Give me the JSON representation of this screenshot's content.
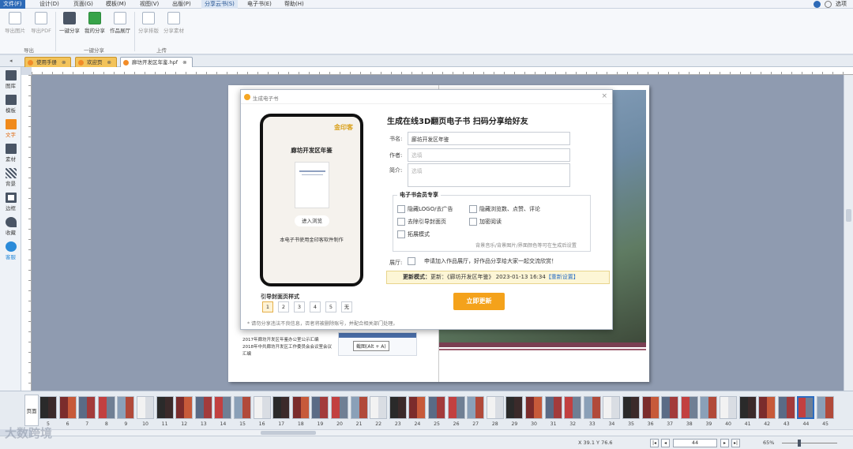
{
  "menubar": {
    "items": [
      "文件(F)",
      "设计(D)",
      "页面(G)",
      "模板(M)",
      "视图(V)",
      "出版(P)",
      "分享云书(S)",
      "电子书(E)",
      "帮助(H)"
    ],
    "active_index": 6,
    "right": "选项"
  },
  "ribbon": {
    "buttons": [
      "导出图片",
      "导出PDF",
      "一键分享",
      "我的分享",
      "作品展厅",
      "分享排版",
      "分享素材"
    ],
    "groups": [
      "导出",
      "一键分享",
      "上传"
    ]
  },
  "tabs": [
    "使用手册",
    "欢迎页",
    "廊坊开发区年鉴.hpf"
  ],
  "left_tools": [
    "图库",
    "模板",
    "文字",
    "素材",
    "背景",
    "边框",
    "收藏",
    "客服"
  ],
  "dialog": {
    "title": "生成电子书",
    "heading": "生成在线3D翻页电子书 扫码分享给好友",
    "book_label": "书名:",
    "book_value": "廊坊开发区年鉴",
    "author_label": "作者:",
    "author_placeholder": "选填",
    "intro_label": "简介:",
    "intro_placeholder": "选填",
    "vip_title": "电子书会员专享",
    "vip_options": [
      "隐藏LOGO/去广告",
      "隐藏浏览数、点赞、评论",
      "去除引导封面页",
      "加密阅读",
      "拓展模式"
    ],
    "vip_note": "背景音乐/背景图片/界面颜色等可在生成后设置",
    "gallery_label": "展厅:",
    "gallery_text": "申请加入作品展厅，好作品分享给大家一起交流欣赏！",
    "update_prefix": "更新模式：",
    "update_text": "更新：《廊坊开发区年鉴》 2023-01-13 16:34",
    "update_link": "【重新设置】",
    "submit": "立即更新",
    "cover_style_label": "引导封面页样式",
    "cover_styles": [
      "1",
      "2",
      "3",
      "4",
      "5",
      "无"
    ],
    "cover_style_selected": 0,
    "footnote": "* 请勿分享违法不良信息，否者将被删除账号，并配合相关部门处理。",
    "phone": {
      "brand": "金印客",
      "title": "廊坊开发区年鉴",
      "enter": "进入浏览",
      "made": "本电子书使用金印客软件制作"
    }
  },
  "page_text": {
    "line1": "2017年廊坊开发区年鉴办公室公示汇编",
    "line2": "2018年中共廊坊开发区工作委员会会议室会议",
    "line3": "汇编",
    "screenshot_tip": "截图(Alt + A)"
  },
  "thumbs": {
    "numbers": [
      "5",
      "6",
      "7",
      "8",
      "9",
      "10",
      "11",
      "12",
      "13",
      "14",
      "15",
      "16",
      "17",
      "18",
      "19",
      "20",
      "21",
      "22",
      "23",
      "24",
      "25",
      "26",
      "27",
      "28",
      "29",
      "30",
      "31",
      "32",
      "33",
      "34",
      "35",
      "36",
      "37",
      "38",
      "39",
      "40",
      "41",
      "42",
      "43",
      "44",
      "45"
    ],
    "selected_number": "44",
    "side_label": "页面"
  },
  "status": {
    "coords": "X 39.1   Y 76.6",
    "page_number": "44",
    "zoom": "65%"
  },
  "watermark": "大数跨境"
}
